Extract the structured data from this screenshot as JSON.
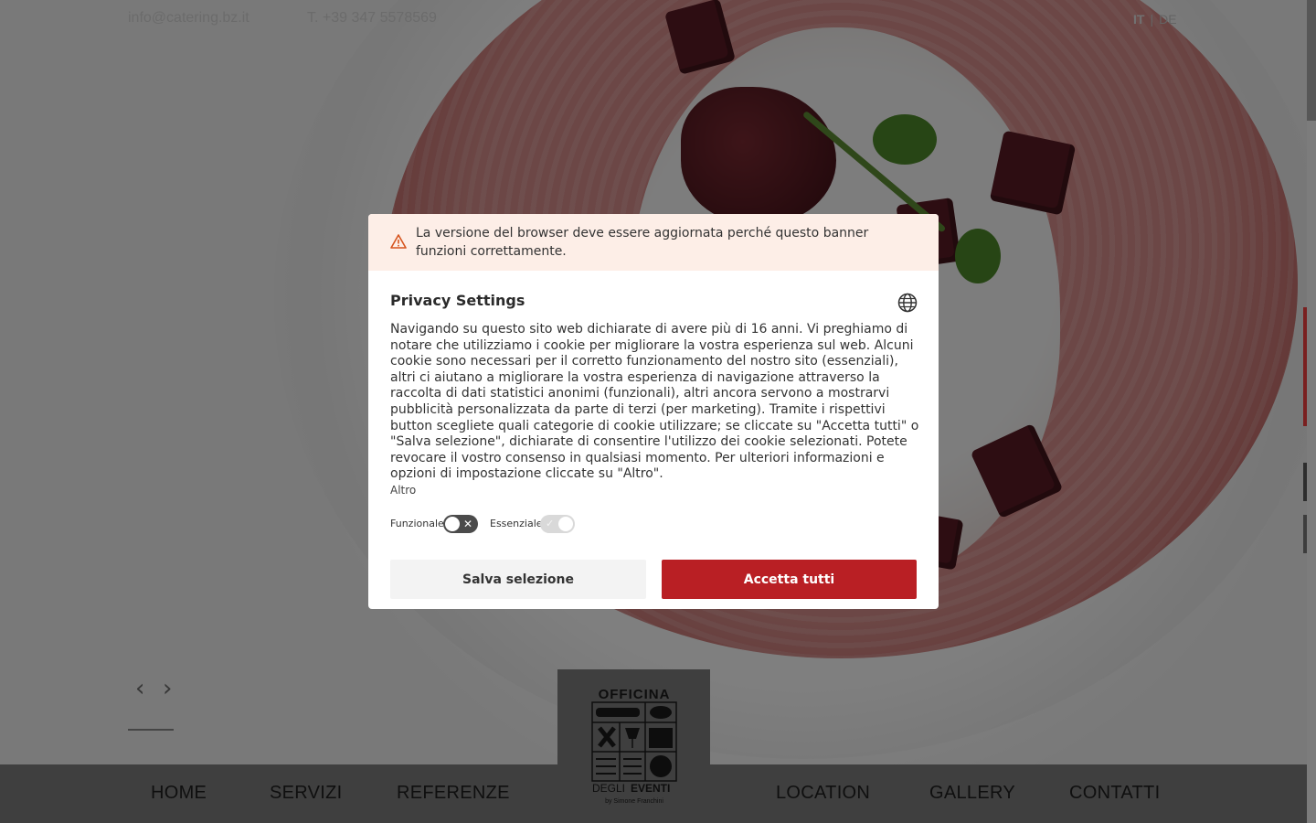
{
  "topbar": {
    "email": "info@catering.bz.it",
    "phone": "T. +39 347 5578569",
    "lang_it": "IT",
    "lang_sep": "|",
    "lang_de": "DE"
  },
  "slider": {
    "prev_glyph": "‹",
    "next_glyph": "›"
  },
  "nav": {
    "home": "HOME",
    "servizi": "SERVIZI",
    "referenze": "REFERENZE",
    "location": "LOCATION",
    "gallery": "GALLERY",
    "contatti": "CONTATTI"
  },
  "logo": {
    "line1": "OFFICINA",
    "line2a": "DEGLI",
    "line2b": "EVENTI",
    "line3": "by Simone Franchini"
  },
  "consent": {
    "warning": "La versione del browser deve essere aggiornata perché questo banner funzioni correttamente.",
    "title": "Privacy Settings",
    "body": "Navigando su questo sito web dichiarate di avere più di 16 anni. Vi preghiamo di notare che utilizziamo i cookie per migliorare la vostra esperienza sul web. Alcuni cookie sono necessari per il corretto funzionamento del nostro sito (essenziali), altri ci aiutano a migliorare la vostra esperienza di navigazione attraverso la raccolta di dati statistici anonimi (funzionali), altri ancora servono a mostrarvi pubblicità personalizzata da parte di terzi (per marketing). Tramite i rispettivi button scegliete quali categorie di cookie utilizzare; se cliccate su \"Accetta tutti\" o \"Salva selezione\", dichiarate di consentire l'utilizzo dei cookie selezionati. Potete revocare il vostro consenso in qualsiasi momento. Per ulteriori informazioni e opzioni di impostazione cliccate su \"Altro\".",
    "more_link": "Altro",
    "toggle_functional_label": "Funzionale",
    "toggle_functional_on": false,
    "toggle_essential_label": "Essenziale",
    "toggle_essential_on": true,
    "save_label": "Salva selezione",
    "accept_label": "Accetta tutti",
    "accent_color": "#b91f24"
  },
  "icons": {
    "warning": "warning-triangle-icon",
    "language": "globe-icon"
  }
}
